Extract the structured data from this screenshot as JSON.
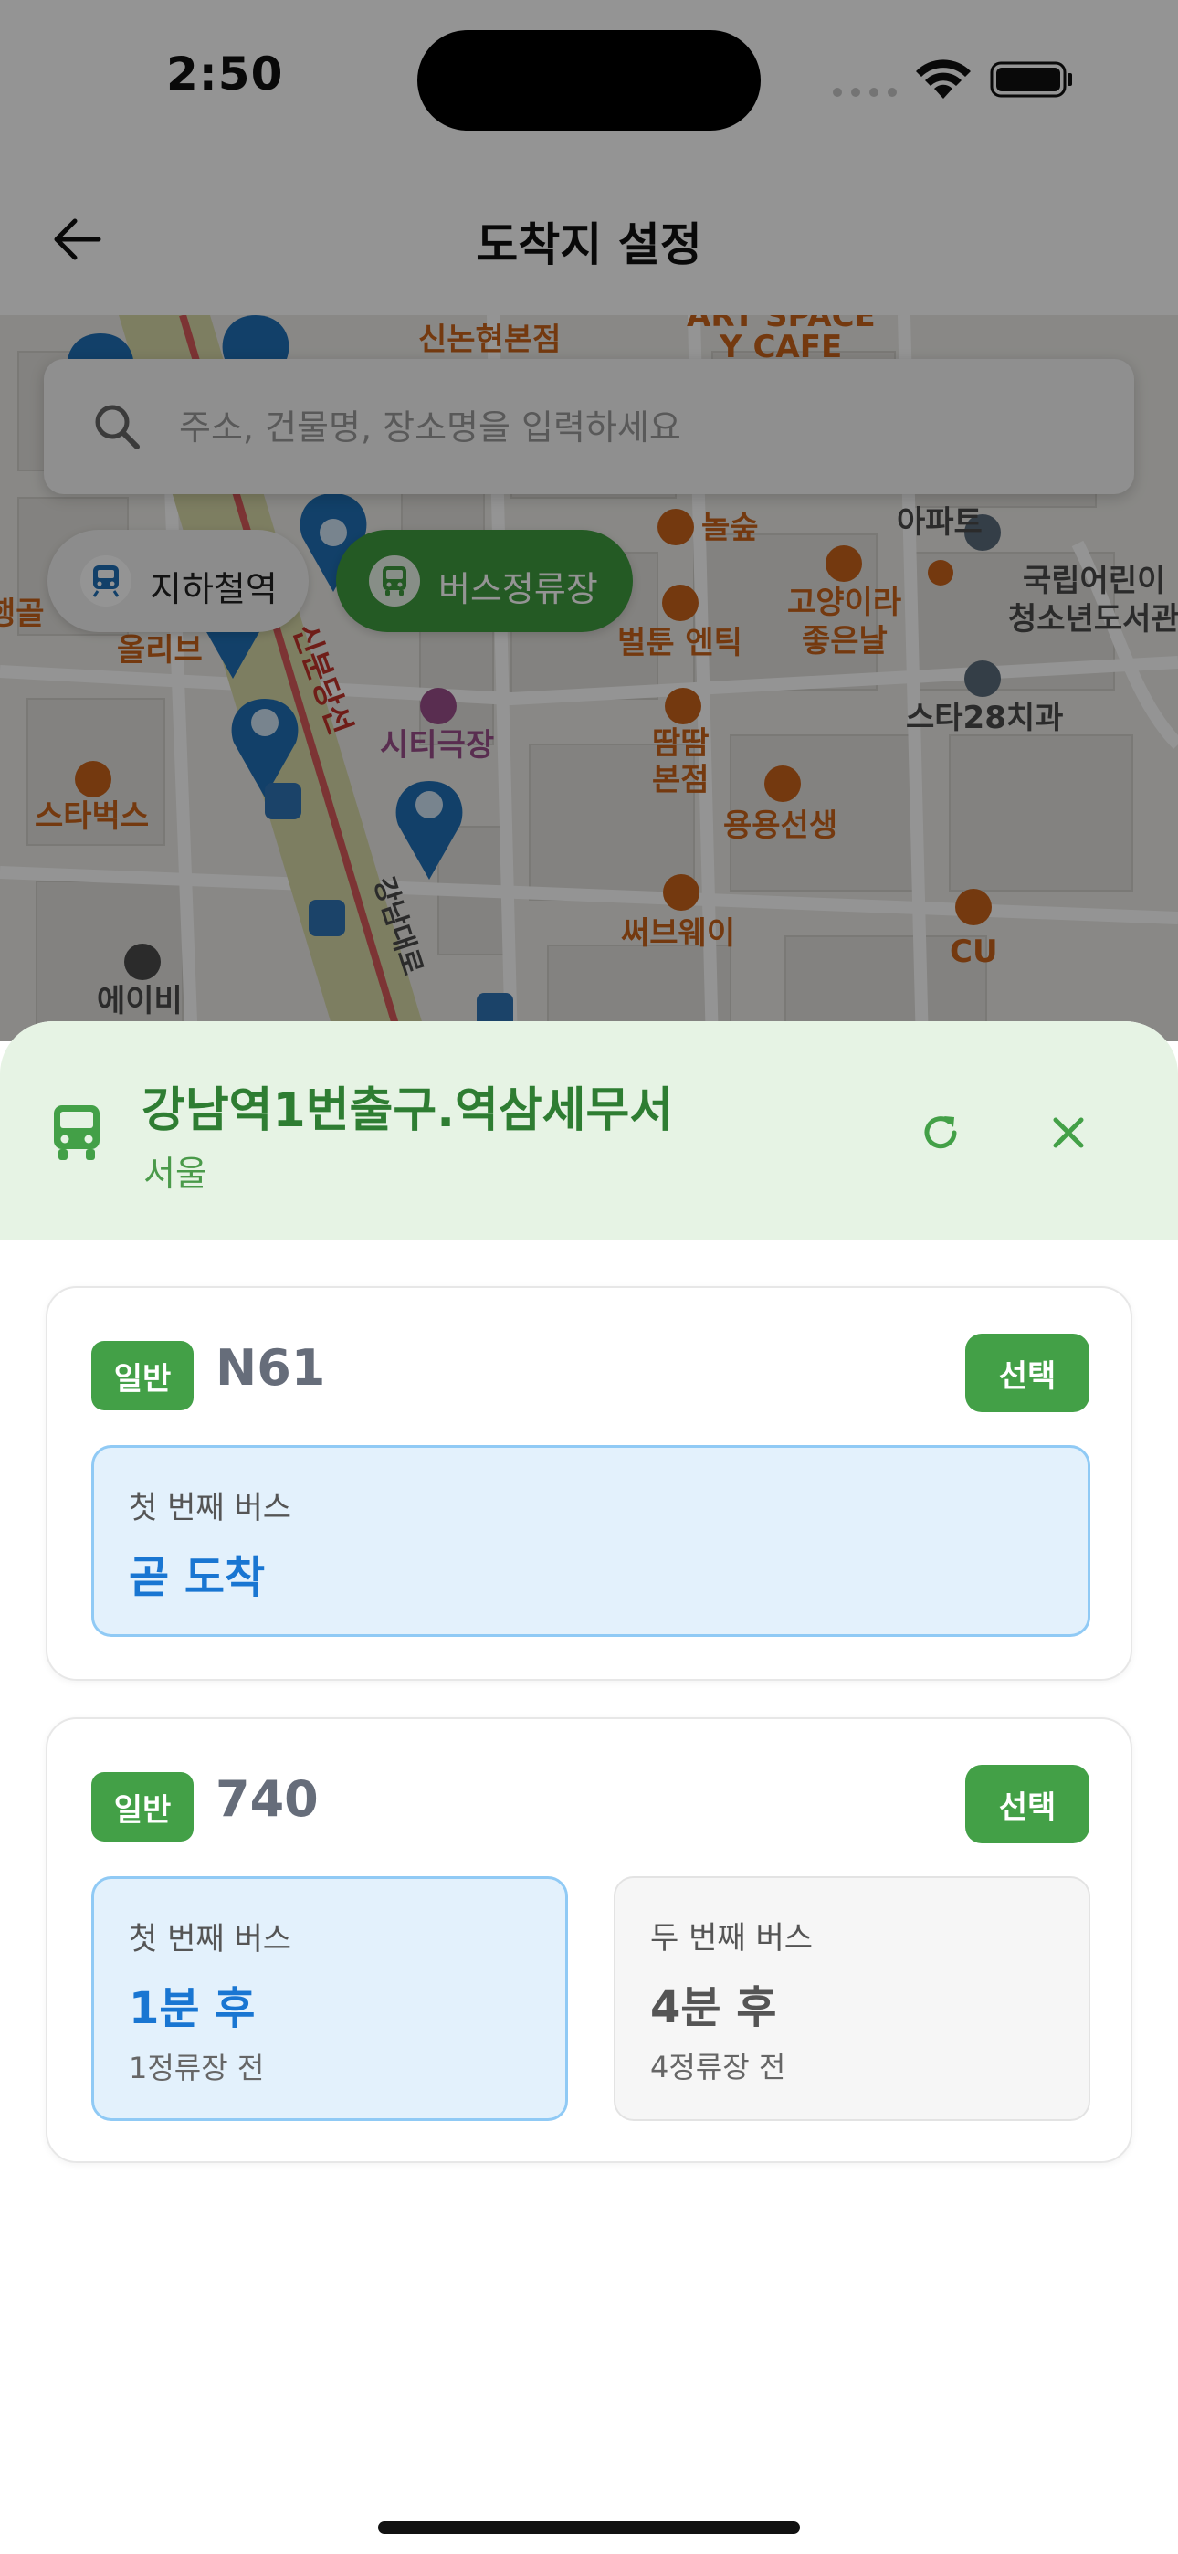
{
  "status_bar": {
    "time": "2:50"
  },
  "header": {
    "title": "도착지 설정",
    "back_icon": "arrow-left-icon"
  },
  "search": {
    "placeholder": "주소, 건물명, 장소명을 입력하세요",
    "value": ""
  },
  "filters": [
    {
      "label": "지하철역",
      "icon": "subway-icon",
      "active": false
    },
    {
      "label": "버스정류장",
      "icon": "bus-icon",
      "active": true
    }
  ],
  "map": {
    "labels": [
      "신논현본점",
      "ART SPACE",
      "Y CAFE",
      "놀숲",
      "아파트",
      "국립어린이",
      "청소년도서관",
      "고양이라",
      "좋은날",
      "벌툰 엔틱",
      "스타28치과",
      "시티극장",
      "땀땀",
      "본점",
      "용용선생",
      "써브웨이",
      "CU",
      "스타벅스",
      "올리브",
      "에이비",
      "신분당선",
      "강남대로",
      "행골"
    ]
  },
  "stop": {
    "name": "강남역1번출구.역삼세무서",
    "region": "서울"
  },
  "routes": [
    {
      "type": "일반",
      "number": "N61",
      "select_label": "선택",
      "arrivals": [
        {
          "label": "첫 번째 버스",
          "time": "곧 도착",
          "stops": ""
        }
      ]
    },
    {
      "type": "일반",
      "number": "740",
      "select_label": "선택",
      "arrivals": [
        {
          "label": "첫 번째 버스",
          "time": "1분 후",
          "stops": "1정류장 전"
        },
        {
          "label": "두 번째 버스",
          "time": "4분 후",
          "stops": "4정류장 전"
        }
      ]
    }
  ],
  "colors": {
    "primary_green": "#43a047",
    "stop_name_green": "#2e7d32",
    "sheet_header_bg": "#e6f3e4",
    "arrival_blue": "#1976d2",
    "arrival_box_blue": "#e3f1fc"
  }
}
